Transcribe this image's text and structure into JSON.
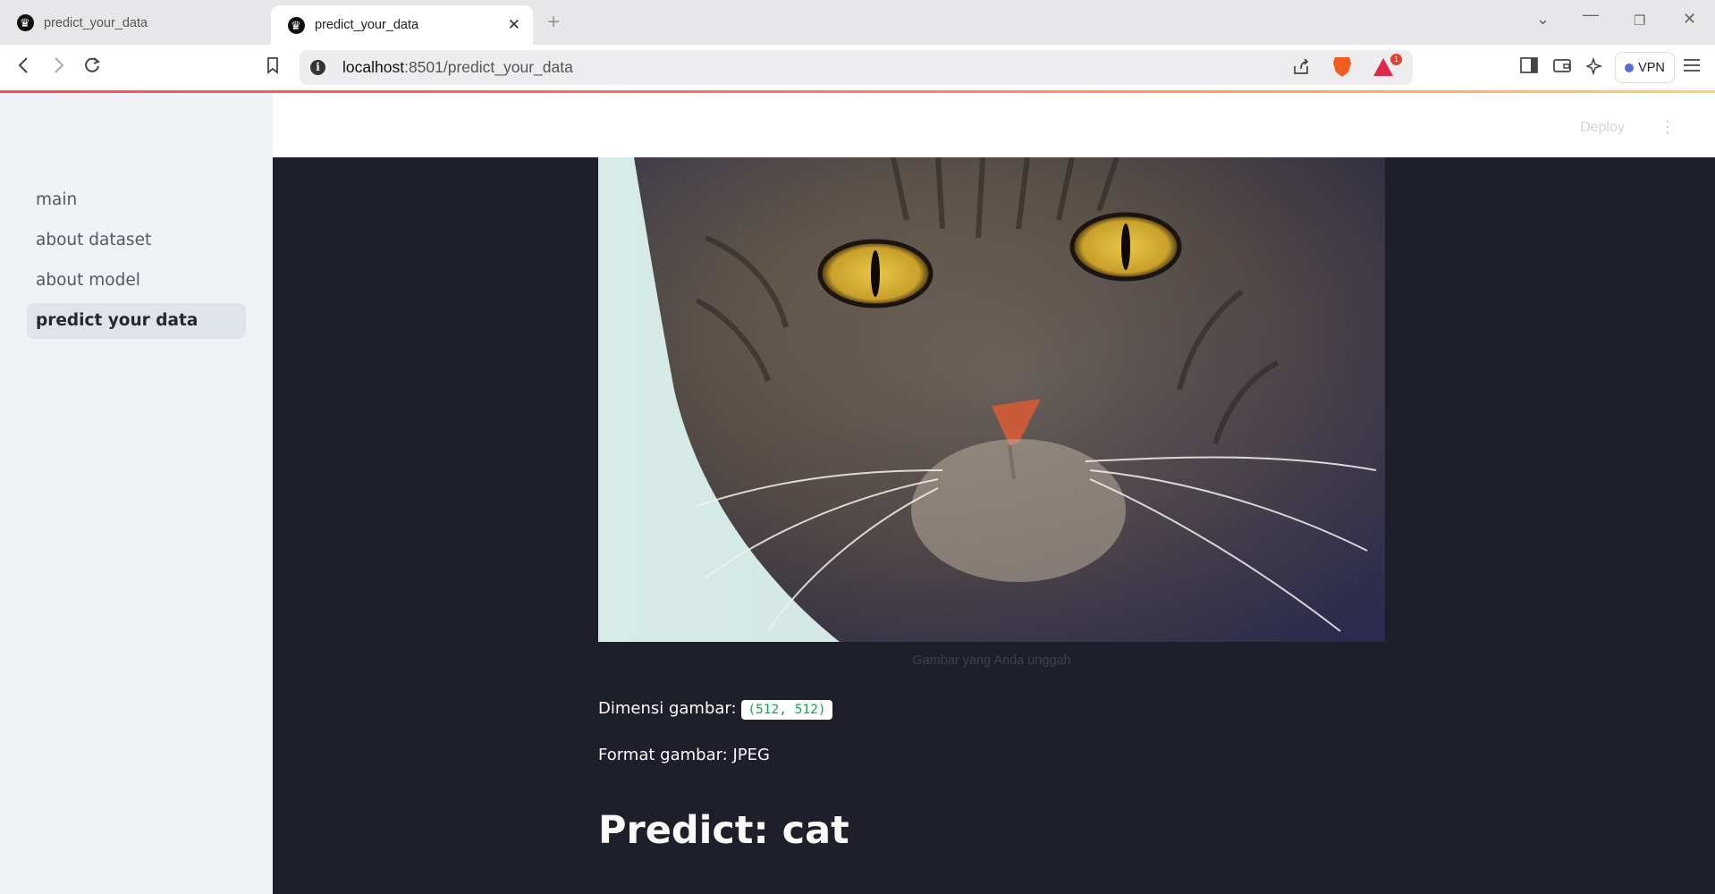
{
  "browser": {
    "tabs": [
      {
        "title": "predict_your_data",
        "active": false
      },
      {
        "title": "predict_your_data",
        "active": true
      }
    ],
    "url_host": "localhost",
    "url_rest": ":8501/predict_your_data",
    "vpn_label": "VPN",
    "rewards_badge": "1"
  },
  "header": {
    "deploy_label": "Deploy",
    "menu_glyph": "⋮"
  },
  "sidebar": {
    "items": [
      {
        "label": "main",
        "active": false
      },
      {
        "label": "about dataset",
        "active": false
      },
      {
        "label": "about model",
        "active": false
      },
      {
        "label": "predict your data",
        "active": true
      }
    ]
  },
  "main": {
    "image_caption": "Gambar yang Anda unggah",
    "dimension_label": "Dimensi gambar:",
    "dimension_value": "(512, 512)",
    "format_text": "Format gambar: JPEG",
    "prediction": "Predict: cat"
  },
  "colors": {
    "sidebar_bg": "#f0f2f6",
    "main_bg": "#1f1f2b",
    "accent": "#ff4b4b",
    "code_text": "#15a34a"
  },
  "icons": [
    "back-icon",
    "forward-icon",
    "reload-icon",
    "bookmark-icon",
    "info-icon",
    "share-icon",
    "brave-shield-icon",
    "rewards-icon",
    "sidebar-toggle-icon",
    "wallet-icon",
    "leo-ai-icon",
    "menu-icon"
  ]
}
